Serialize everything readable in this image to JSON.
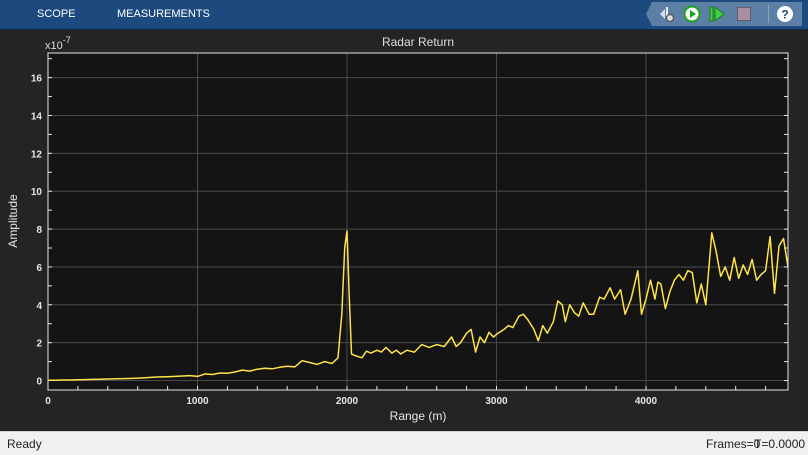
{
  "toolbar": {
    "tabs": [
      "SCOPE",
      "MEASUREMENTS"
    ],
    "icons": [
      "signal-settings-icon",
      "run-icon",
      "step-forward-icon",
      "stop-icon",
      "help-icon"
    ]
  },
  "status": {
    "left": "Ready",
    "frames": "Frames=0",
    "time": "T=0.0000"
  },
  "colors": {
    "line": "#ffe34a",
    "plot_bg": "#141414",
    "figure_bg": "#242424",
    "toolbar": "#1c4a7e"
  },
  "chart_data": {
    "type": "line",
    "title": "Radar Return",
    "xlabel": "Range (m)",
    "ylabel": "Amplitude",
    "yexponent": "x10",
    "yexponent_power": "-7",
    "xlim": [
      0,
      4950
    ],
    "ylim": [
      -0.5,
      17.3
    ],
    "xticks": [
      0,
      1000,
      2000,
      3000,
      4000
    ],
    "yticks": [
      0,
      2,
      4,
      6,
      8,
      10,
      12,
      14,
      16
    ],
    "grid": true,
    "series": [
      {
        "name": "Radar Return",
        "x": [
          0,
          50,
          100,
          150,
          200,
          250,
          300,
          350,
          400,
          450,
          500,
          550,
          600,
          650,
          700,
          750,
          800,
          850,
          900,
          950,
          1000,
          1050,
          1100,
          1150,
          1200,
          1250,
          1300,
          1350,
          1400,
          1450,
          1500,
          1550,
          1600,
          1650,
          1700,
          1750,
          1800,
          1850,
          1900,
          1940,
          1965,
          1985,
          2000,
          2015,
          2030,
          2060,
          2100,
          2130,
          2160,
          2200,
          2230,
          2260,
          2300,
          2330,
          2360,
          2400,
          2450,
          2500,
          2550,
          2600,
          2650,
          2700,
          2730,
          2760,
          2800,
          2830,
          2860,
          2890,
          2920,
          2950,
          2980,
          3010,
          3050,
          3080,
          3110,
          3150,
          3180,
          3210,
          3250,
          3280,
          3310,
          3340,
          3380,
          3410,
          3440,
          3460,
          3490,
          3520,
          3550,
          3580,
          3620,
          3650,
          3690,
          3720,
          3760,
          3790,
          3830,
          3860,
          3900,
          3945,
          3970,
          4000,
          4030,
          4060,
          4080,
          4100,
          4130,
          4160,
          4190,
          4220,
          4250,
          4280,
          4310,
          4340,
          4370,
          4400,
          4440,
          4470,
          4500,
          4530,
          4560,
          4590,
          4620,
          4650,
          4680,
          4710,
          4740,
          4770,
          4800,
          4830,
          4860,
          4890,
          4920,
          4950
        ],
        "y": [
          0.02,
          0.02,
          0.03,
          0.03,
          0.04,
          0.05,
          0.06,
          0.07,
          0.08,
          0.09,
          0.1,
          0.11,
          0.13,
          0.15,
          0.17,
          0.19,
          0.2,
          0.22,
          0.24,
          0.26,
          0.22,
          0.35,
          0.32,
          0.4,
          0.38,
          0.45,
          0.55,
          0.5,
          0.6,
          0.65,
          0.62,
          0.7,
          0.75,
          0.72,
          1.05,
          0.95,
          0.85,
          1.0,
          0.9,
          1.2,
          3.5,
          7.0,
          7.9,
          4.5,
          1.4,
          1.3,
          1.2,
          1.55,
          1.45,
          1.6,
          1.5,
          1.75,
          1.45,
          1.6,
          1.4,
          1.6,
          1.5,
          1.9,
          1.75,
          1.9,
          1.8,
          2.3,
          1.8,
          2.0,
          2.5,
          2.7,
          1.5,
          2.3,
          2.0,
          2.55,
          2.3,
          2.5,
          2.7,
          2.9,
          2.8,
          3.4,
          3.5,
          3.2,
          2.7,
          2.1,
          2.9,
          2.5,
          3.1,
          4.2,
          4.0,
          3.1,
          4.0,
          3.6,
          3.4,
          4.1,
          3.5,
          3.5,
          4.4,
          4.3,
          4.9,
          4.3,
          4.8,
          3.5,
          4.3,
          5.8,
          3.5,
          4.3,
          5.3,
          4.3,
          5.2,
          5.1,
          3.8,
          4.7,
          5.3,
          5.6,
          5.3,
          5.8,
          5.7,
          4.1,
          5.1,
          4.0,
          7.8,
          6.8,
          5.5,
          6.0,
          5.3,
          6.5,
          5.4,
          6.1,
          5.6,
          6.4,
          5.3,
          5.6,
          5.8,
          7.6,
          4.6,
          7.1,
          7.5,
          6.0
        ]
      }
    ]
  }
}
